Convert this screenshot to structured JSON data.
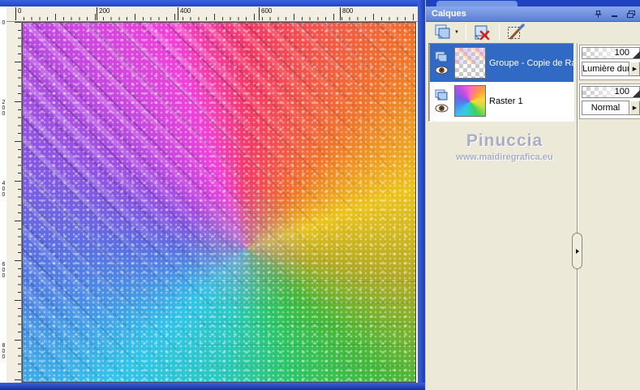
{
  "image_window": {
    "rulers": {
      "horizontal": [
        "0",
        "200",
        "400",
        "600",
        "800"
      ],
      "vertical": [
        "0",
        "200",
        "400",
        "600",
        "800"
      ]
    }
  },
  "palette": {
    "title": "Calques",
    "titlebar_icons": [
      "pin-icon",
      "minimize-icon",
      "float-icon"
    ],
    "toolbar_icons": [
      "new-layer-icon",
      "new-layer-dropdown-arrow",
      "delete-layer-icon",
      "edit-selection-icon"
    ],
    "dropdown_arrow_glyph": "▶",
    "layers": [
      {
        "name": "Groupe - Copie de Raste",
        "opacity": "100",
        "blend_mode": "Lumière dure",
        "selected": true,
        "visible": true
      },
      {
        "name": "Raster 1",
        "opacity": "100",
        "blend_mode": "Normal",
        "selected": false,
        "visible": true
      }
    ],
    "watermark": {
      "name": "Pinuccia",
      "url": "www.maidiregrafica.eu"
    }
  },
  "colors": {
    "selection_blue": "#316ac5",
    "titlebar_blue": "#6e91dd",
    "window_frame_blue": "#2b50d4",
    "workspace_beige": "#ece9d8"
  }
}
